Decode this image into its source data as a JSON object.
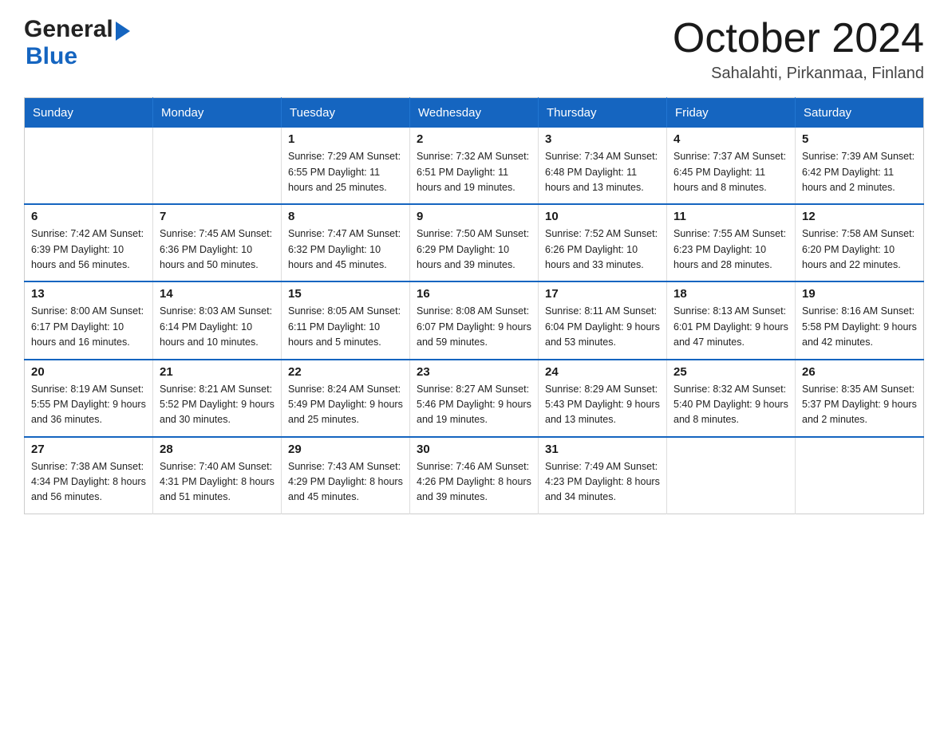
{
  "header": {
    "logo_general": "General",
    "logo_blue": "Blue",
    "month_title": "October 2024",
    "location": "Sahalahti, Pirkanmaa, Finland"
  },
  "calendar": {
    "days_of_week": [
      "Sunday",
      "Monday",
      "Tuesday",
      "Wednesday",
      "Thursday",
      "Friday",
      "Saturday"
    ],
    "weeks": [
      [
        {
          "day": "",
          "info": ""
        },
        {
          "day": "",
          "info": ""
        },
        {
          "day": "1",
          "info": "Sunrise: 7:29 AM\nSunset: 6:55 PM\nDaylight: 11 hours\nand 25 minutes."
        },
        {
          "day": "2",
          "info": "Sunrise: 7:32 AM\nSunset: 6:51 PM\nDaylight: 11 hours\nand 19 minutes."
        },
        {
          "day": "3",
          "info": "Sunrise: 7:34 AM\nSunset: 6:48 PM\nDaylight: 11 hours\nand 13 minutes."
        },
        {
          "day": "4",
          "info": "Sunrise: 7:37 AM\nSunset: 6:45 PM\nDaylight: 11 hours\nand 8 minutes."
        },
        {
          "day": "5",
          "info": "Sunrise: 7:39 AM\nSunset: 6:42 PM\nDaylight: 11 hours\nand 2 minutes."
        }
      ],
      [
        {
          "day": "6",
          "info": "Sunrise: 7:42 AM\nSunset: 6:39 PM\nDaylight: 10 hours\nand 56 minutes."
        },
        {
          "day": "7",
          "info": "Sunrise: 7:45 AM\nSunset: 6:36 PM\nDaylight: 10 hours\nand 50 minutes."
        },
        {
          "day": "8",
          "info": "Sunrise: 7:47 AM\nSunset: 6:32 PM\nDaylight: 10 hours\nand 45 minutes."
        },
        {
          "day": "9",
          "info": "Sunrise: 7:50 AM\nSunset: 6:29 PM\nDaylight: 10 hours\nand 39 minutes."
        },
        {
          "day": "10",
          "info": "Sunrise: 7:52 AM\nSunset: 6:26 PM\nDaylight: 10 hours\nand 33 minutes."
        },
        {
          "day": "11",
          "info": "Sunrise: 7:55 AM\nSunset: 6:23 PM\nDaylight: 10 hours\nand 28 minutes."
        },
        {
          "day": "12",
          "info": "Sunrise: 7:58 AM\nSunset: 6:20 PM\nDaylight: 10 hours\nand 22 minutes."
        }
      ],
      [
        {
          "day": "13",
          "info": "Sunrise: 8:00 AM\nSunset: 6:17 PM\nDaylight: 10 hours\nand 16 minutes."
        },
        {
          "day": "14",
          "info": "Sunrise: 8:03 AM\nSunset: 6:14 PM\nDaylight: 10 hours\nand 10 minutes."
        },
        {
          "day": "15",
          "info": "Sunrise: 8:05 AM\nSunset: 6:11 PM\nDaylight: 10 hours\nand 5 minutes."
        },
        {
          "day": "16",
          "info": "Sunrise: 8:08 AM\nSunset: 6:07 PM\nDaylight: 9 hours\nand 59 minutes."
        },
        {
          "day": "17",
          "info": "Sunrise: 8:11 AM\nSunset: 6:04 PM\nDaylight: 9 hours\nand 53 minutes."
        },
        {
          "day": "18",
          "info": "Sunrise: 8:13 AM\nSunset: 6:01 PM\nDaylight: 9 hours\nand 47 minutes."
        },
        {
          "day": "19",
          "info": "Sunrise: 8:16 AM\nSunset: 5:58 PM\nDaylight: 9 hours\nand 42 minutes."
        }
      ],
      [
        {
          "day": "20",
          "info": "Sunrise: 8:19 AM\nSunset: 5:55 PM\nDaylight: 9 hours\nand 36 minutes."
        },
        {
          "day": "21",
          "info": "Sunrise: 8:21 AM\nSunset: 5:52 PM\nDaylight: 9 hours\nand 30 minutes."
        },
        {
          "day": "22",
          "info": "Sunrise: 8:24 AM\nSunset: 5:49 PM\nDaylight: 9 hours\nand 25 minutes."
        },
        {
          "day": "23",
          "info": "Sunrise: 8:27 AM\nSunset: 5:46 PM\nDaylight: 9 hours\nand 19 minutes."
        },
        {
          "day": "24",
          "info": "Sunrise: 8:29 AM\nSunset: 5:43 PM\nDaylight: 9 hours\nand 13 minutes."
        },
        {
          "day": "25",
          "info": "Sunrise: 8:32 AM\nSunset: 5:40 PM\nDaylight: 9 hours\nand 8 minutes."
        },
        {
          "day": "26",
          "info": "Sunrise: 8:35 AM\nSunset: 5:37 PM\nDaylight: 9 hours\nand 2 minutes."
        }
      ],
      [
        {
          "day": "27",
          "info": "Sunrise: 7:38 AM\nSunset: 4:34 PM\nDaylight: 8 hours\nand 56 minutes."
        },
        {
          "day": "28",
          "info": "Sunrise: 7:40 AM\nSunset: 4:31 PM\nDaylight: 8 hours\nand 51 minutes."
        },
        {
          "day": "29",
          "info": "Sunrise: 7:43 AM\nSunset: 4:29 PM\nDaylight: 8 hours\nand 45 minutes."
        },
        {
          "day": "30",
          "info": "Sunrise: 7:46 AM\nSunset: 4:26 PM\nDaylight: 8 hours\nand 39 minutes."
        },
        {
          "day": "31",
          "info": "Sunrise: 7:49 AM\nSunset: 4:23 PM\nDaylight: 8 hours\nand 34 minutes."
        },
        {
          "day": "",
          "info": ""
        },
        {
          "day": "",
          "info": ""
        }
      ]
    ]
  }
}
